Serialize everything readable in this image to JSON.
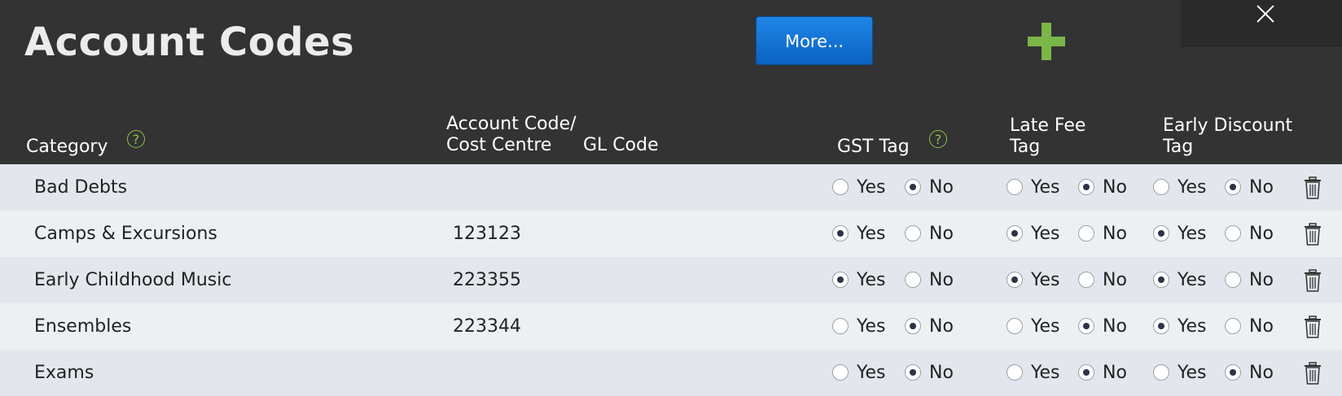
{
  "header": {
    "title": "Account Codes",
    "more_label": "More...",
    "add_icon": "plus-icon",
    "close_icon": "close-icon"
  },
  "columns": {
    "category": "Category",
    "account_code_line1": "Account Code/",
    "account_code_line2": "Cost Centre",
    "gl_code": "GL Code",
    "gst_tag": "GST Tag",
    "late_fee_line1": "Late Fee",
    "late_fee_line2": "Tag",
    "early_discount_line1": "Early Discount",
    "early_discount_line2": "Tag",
    "help_icon": "help-icon"
  },
  "labels": {
    "yes": "Yes",
    "no": "No"
  },
  "rows": [
    {
      "category": "Bad Debts",
      "account_code": "",
      "gl_code": "",
      "gst": "No",
      "late_fee": "No",
      "early_discount": "No"
    },
    {
      "category": "Camps & Excursions",
      "account_code": "123123",
      "gl_code": "",
      "gst": "Yes",
      "late_fee": "Yes",
      "early_discount": "Yes"
    },
    {
      "category": "Early Childhood Music",
      "account_code": "223355",
      "gl_code": "",
      "gst": "Yes",
      "late_fee": "Yes",
      "early_discount": "Yes"
    },
    {
      "category": "Ensembles",
      "account_code": "223344",
      "gl_code": "",
      "gst": "No",
      "late_fee": "No",
      "early_discount": "Yes"
    },
    {
      "category": "Exams",
      "account_code": "",
      "gl_code": "",
      "gst": "No",
      "late_fee": "No",
      "early_discount": "No"
    }
  ],
  "colors": {
    "accent_blue": "#0b62c2",
    "add_green": "#7ab648",
    "help_green": "#8dc24a",
    "header_bg": "#333333"
  }
}
